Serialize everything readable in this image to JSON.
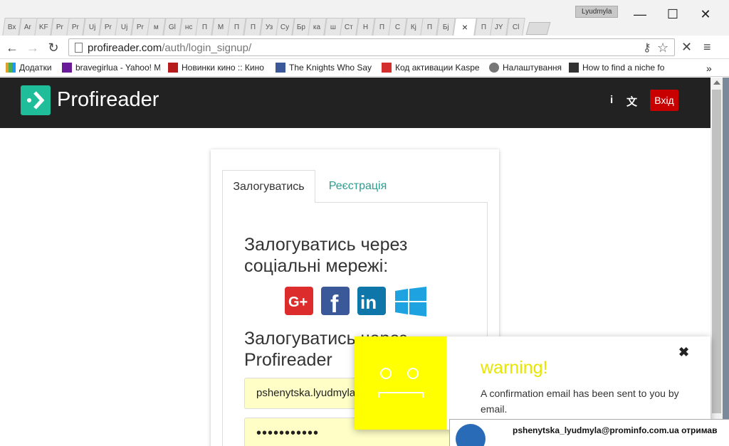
{
  "browser": {
    "tabs": [
      "Вх",
      "Ar",
      "KF",
      "Pr",
      "Pr",
      "Uj",
      "Pr",
      "Uj",
      "Pr",
      "м",
      "Gl",
      "нс",
      "П",
      "M",
      "П",
      "П",
      "Уз",
      "Су",
      "Бр",
      "ка",
      "ш",
      "Ст",
      "Н",
      "П",
      "С",
      "Кј",
      "П",
      "Бј"
    ],
    "active_tab_close": "×",
    "tabs_after": [
      "П",
      "JY",
      "Cl"
    ],
    "profile": "Lyudmyla",
    "minimize": "—",
    "maximize": "☐",
    "close": "✕",
    "url_domain": "profireader.com",
    "url_path": "/auth/login_signup/"
  },
  "bookmarks": [
    {
      "label": "Додатки",
      "icon_color": "#e0a030"
    },
    {
      "label": "bravegirlua - Yahoo! M",
      "icon_color": "#6a1b9a"
    },
    {
      "label": "Новинки кино :: Кино",
      "icon_color": "#b71c1c"
    },
    {
      "label": "The Knights Who Say",
      "icon_color": "#3b5998"
    },
    {
      "label": "Код активации Kaspe",
      "icon_color": "#d32f2f"
    },
    {
      "label": "Налаштування",
      "icon_color": "#777777"
    },
    {
      "label": "How to find a niche fo",
      "icon_color": "#333333"
    }
  ],
  "bookmarks_more": "»",
  "site": {
    "brand": "Profireader",
    "info_icon": "i",
    "lang_icon": "文",
    "login_button": "Вхід",
    "tab_login": "Залогуватись",
    "tab_register": "Реєстрація",
    "social_heading": "Залогуватись через соціальні мережі:",
    "pf_heading": "Залогуватись через Profireader",
    "email_value": "pshenytska.lyudmyla@",
    "password_value": "•••••••••••",
    "social": [
      {
        "name": "G+",
        "color": "#dd2c2c"
      },
      {
        "name": "f",
        "color": "#3b5998"
      },
      {
        "name": "in",
        "color": "#0e76a8"
      },
      {
        "name": "win",
        "color": "#1ea3e0"
      }
    ]
  },
  "notification": {
    "title": "warning!",
    "message": "A confirmation email has been sent to you by email.",
    "close": "✖"
  },
  "toast": {
    "text": "pshenytska_lyudmyla@prominfo.com.ua отримав"
  }
}
